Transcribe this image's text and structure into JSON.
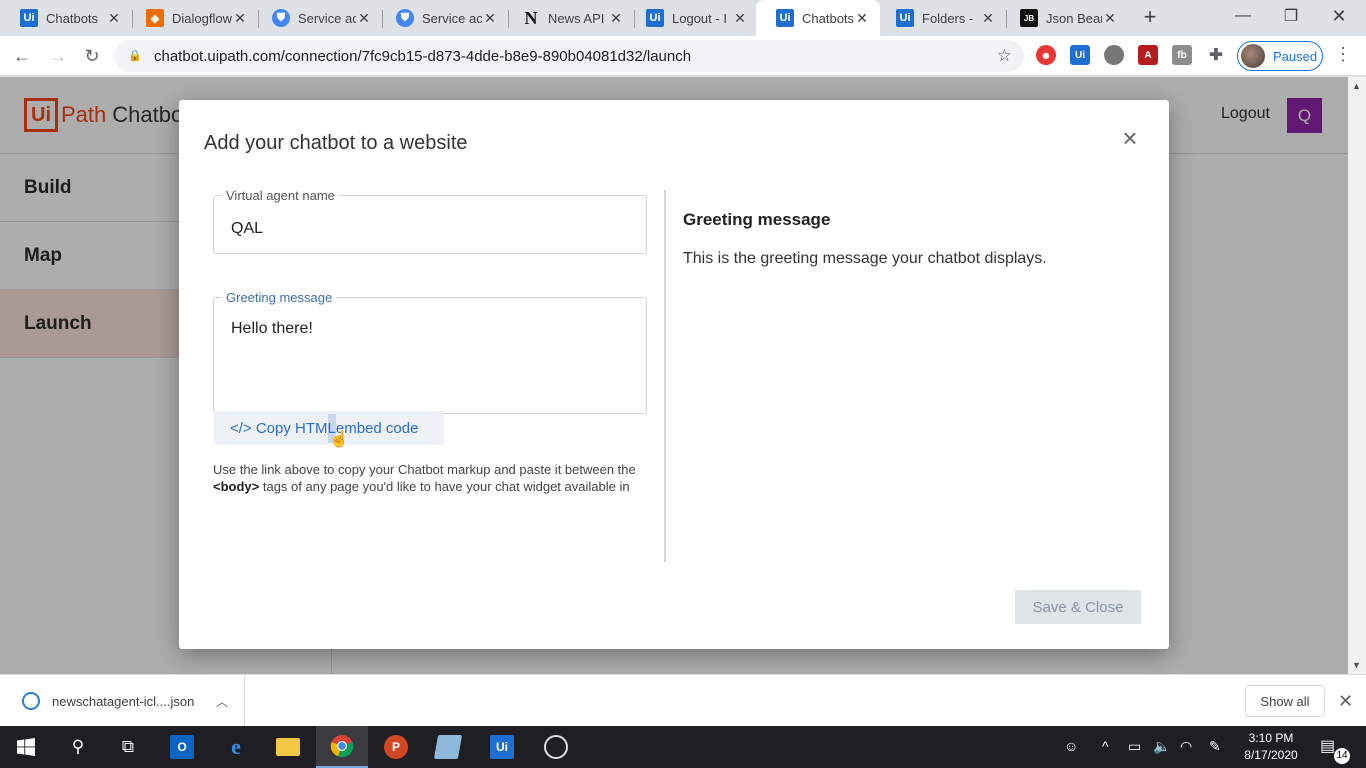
{
  "browser": {
    "tabs": [
      {
        "title": "Chatbots",
        "favicon": "uipath-icon",
        "color": "#1f6fd2",
        "glyph": "Ui"
      },
      {
        "title": "Dialogflow",
        "favicon": "dialogflow-icon",
        "color": "#ef6c00",
        "glyph": "◆"
      },
      {
        "title": "Service ac",
        "favicon": "gcp-shield-icon",
        "color": "#4285f4",
        "glyph": "⛊"
      },
      {
        "title": "Service ac",
        "favicon": "gcp-shield-icon",
        "color": "#4285f4",
        "glyph": "⛊"
      },
      {
        "title": "News API",
        "favicon": "newsapi-icon",
        "color": "#111111",
        "glyph": "N"
      },
      {
        "title": "Logout - I",
        "favicon": "uipath-icon",
        "color": "#1f6fd2",
        "glyph": "Ui"
      },
      {
        "title": "Chatbots",
        "favicon": "uipath-icon",
        "color": "#1f6fd2",
        "glyph": "Ui",
        "active": true
      },
      {
        "title": "Folders - ",
        "favicon": "uipath-icon",
        "color": "#1f6fd2",
        "glyph": "Ui"
      },
      {
        "title": "Json Beau",
        "favicon": "jsonbeautifier-icon",
        "color": "#111111",
        "glyph": "{JB}"
      }
    ],
    "url": "chatbot.uipath.com/connection/7fc9cb15-d873-4dde-b8e9-890b04081d32/launch",
    "profile_status": "Paused"
  },
  "app": {
    "brand_box": "Ui",
    "brand_name": "Path",
    "product": "Chatbots",
    "logout_label": "Logout",
    "user_initial": "Q",
    "accent": "#fa4616",
    "nav": [
      {
        "label": "Build"
      },
      {
        "label": "Map"
      },
      {
        "label": "Launch",
        "selected": true
      }
    ]
  },
  "modal": {
    "title": "Add your chatbot to a website",
    "name_label": "Virtual agent name",
    "name_value": "QAL",
    "greeting_label": "Greeting message",
    "greeting_value": "Hello there!",
    "copy_prefix": "</> Copy HTM",
    "copy_highlight": "L",
    "copy_suffix": " embed code",
    "help_before": "Use the link above to copy your Chatbot markup and paste it between the ",
    "help_tag": "<body>",
    "help_after": " tags of any page you'd like to have your chat widget available in",
    "side_title": "Greeting message",
    "side_desc": "This is the greeting message your chatbot displays.",
    "save_label": "Save & Close"
  },
  "downloads": {
    "file": "newschatagent-icl....json",
    "show_all": "Show all"
  },
  "taskbar": {
    "time": "3:10 PM",
    "date": "8/17/2020",
    "notifications": "14",
    "apps": [
      "outlook-icon",
      "ie-icon",
      "file-explorer-icon",
      "chrome-icon",
      "powerpoint-icon",
      "notepad-icon",
      "uipath-studio-icon",
      "obs-icon"
    ]
  }
}
